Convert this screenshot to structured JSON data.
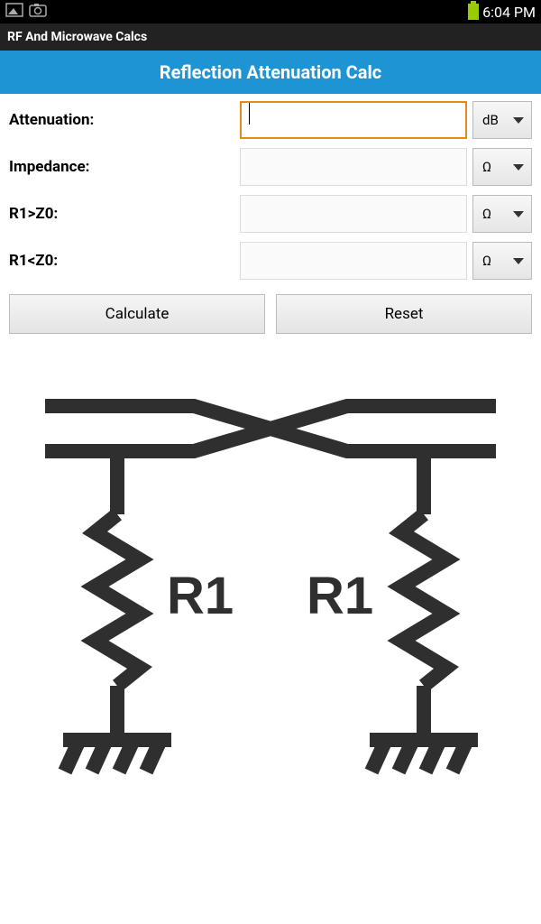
{
  "status": {
    "time": "6:04 PM"
  },
  "app": {
    "name": "RF And Microwave Calcs"
  },
  "title": "Reflection Attenuation Calc",
  "fields": {
    "attenuation": {
      "label": "Attenuation:",
      "value": "",
      "unit": "dB"
    },
    "impedance": {
      "label": "Impedance:",
      "value": "",
      "unit": "Ω"
    },
    "r1gt": {
      "label": "R1>Z0:",
      "value": "",
      "unit": "Ω"
    },
    "r1lt": {
      "label": "R1<Z0:",
      "value": "",
      "unit": "Ω"
    }
  },
  "buttons": {
    "calculate": "Calculate",
    "reset": "Reset"
  },
  "diagram": {
    "label_left": "R1",
    "label_right": "R1"
  }
}
